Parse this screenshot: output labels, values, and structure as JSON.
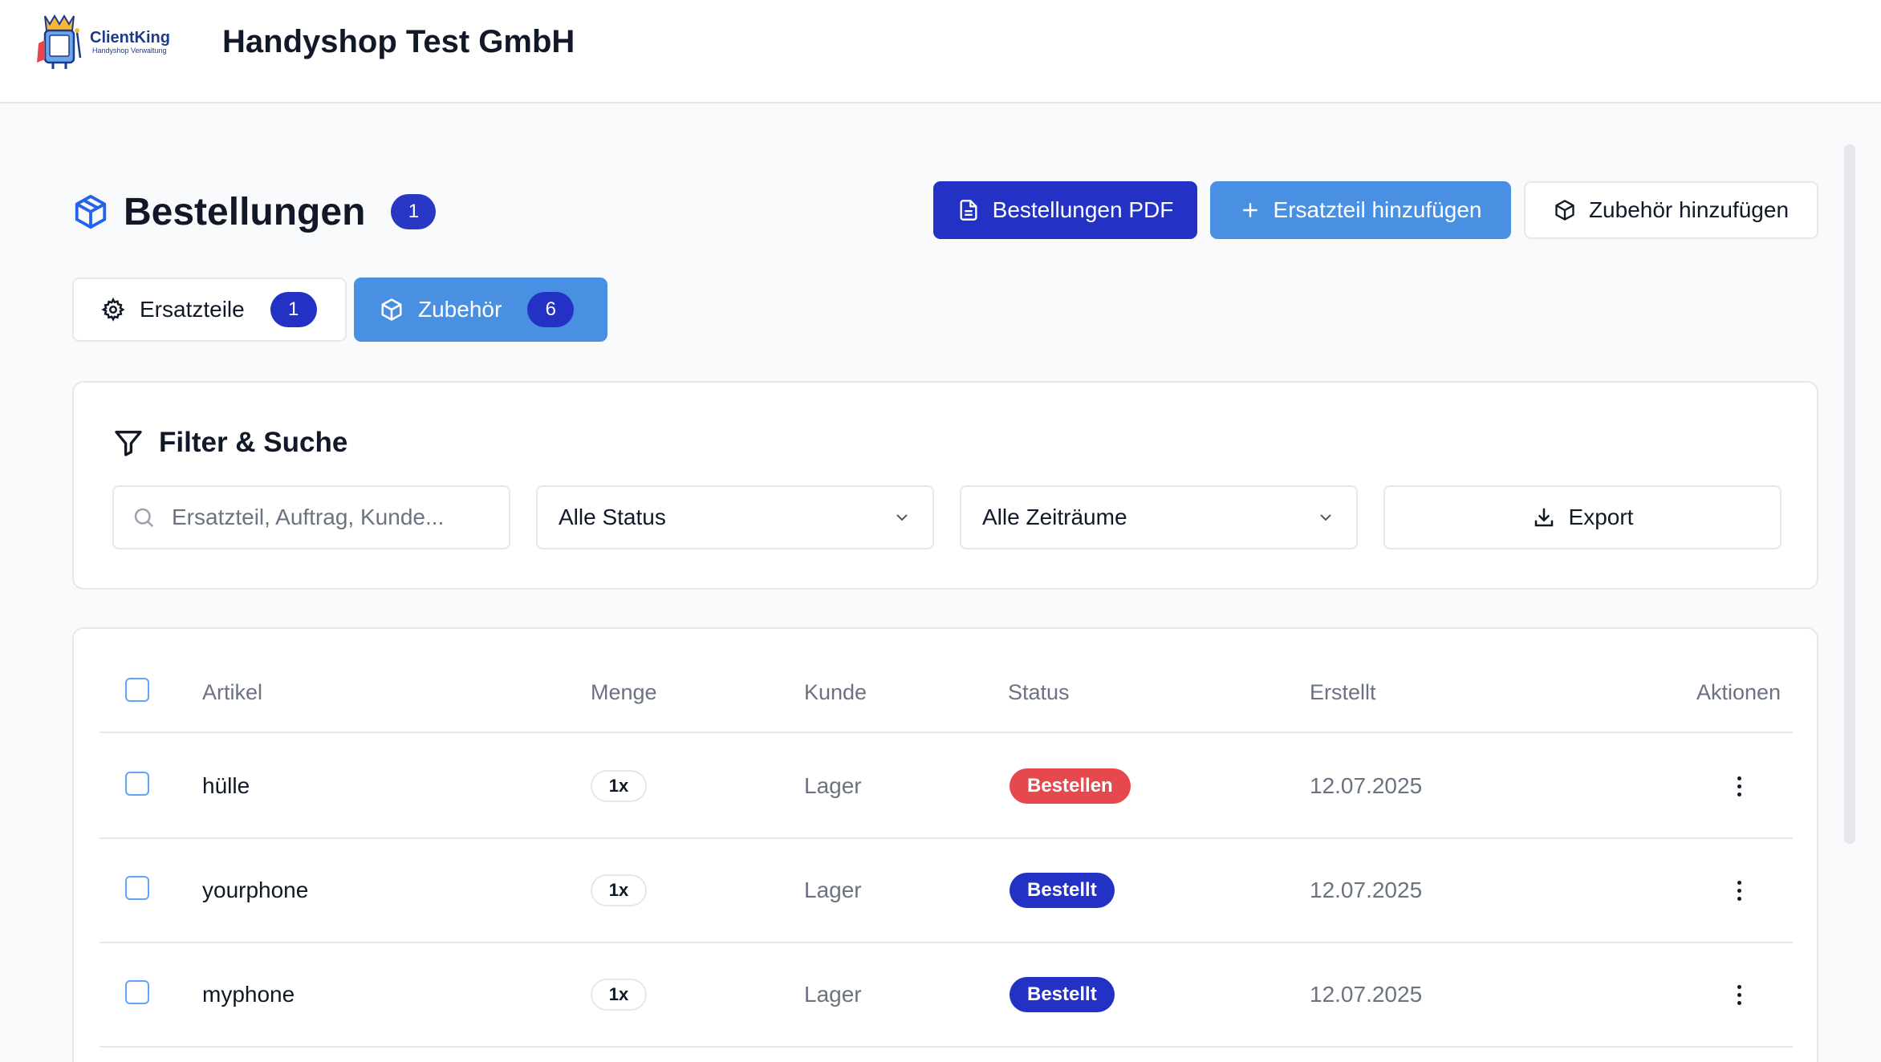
{
  "header": {
    "logo_text": "ClientKing",
    "logo_subtitle": "Handyshop Verwaltung",
    "company": "Handyshop Test GmbH"
  },
  "page": {
    "title": "Bestellungen",
    "title_count": "1",
    "buttons": {
      "pdf": "Bestellungen PDF",
      "add_part": "Ersatzteil hinzufügen",
      "add_accessory": "Zubehör hinzufügen"
    }
  },
  "tabs": [
    {
      "label": "Ersatzteile",
      "count": "1",
      "active": false
    },
    {
      "label": "Zubehör",
      "count": "6",
      "active": true
    }
  ],
  "filter": {
    "title": "Filter & Suche",
    "search_placeholder": "Ersatzteil, Auftrag, Kunde...",
    "status_value": "Alle Status",
    "period_value": "Alle Zeiträume",
    "export_label": "Export"
  },
  "table": {
    "headers": {
      "article": "Artikel",
      "quantity": "Menge",
      "customer": "Kunde",
      "status": "Status",
      "created": "Erstellt",
      "actions": "Aktionen"
    },
    "rows": [
      {
        "article": "hülle",
        "quantity": "1x",
        "customer": "Lager",
        "status": "Bestellen",
        "status_color": "#e5484d",
        "created": "12.07.2025"
      },
      {
        "article": "yourphone",
        "quantity": "1x",
        "customer": "Lager",
        "status": "Bestellt",
        "status_color": "#2332c4",
        "created": "12.07.2025"
      },
      {
        "article": "myphone",
        "quantity": "1x",
        "customer": "Lager",
        "status": "Bestellt",
        "status_color": "#2332c4",
        "created": "12.07.2025"
      }
    ]
  },
  "colors": {
    "primary": "#2332c4",
    "accent": "#4a90e2",
    "danger": "#e5484d"
  }
}
